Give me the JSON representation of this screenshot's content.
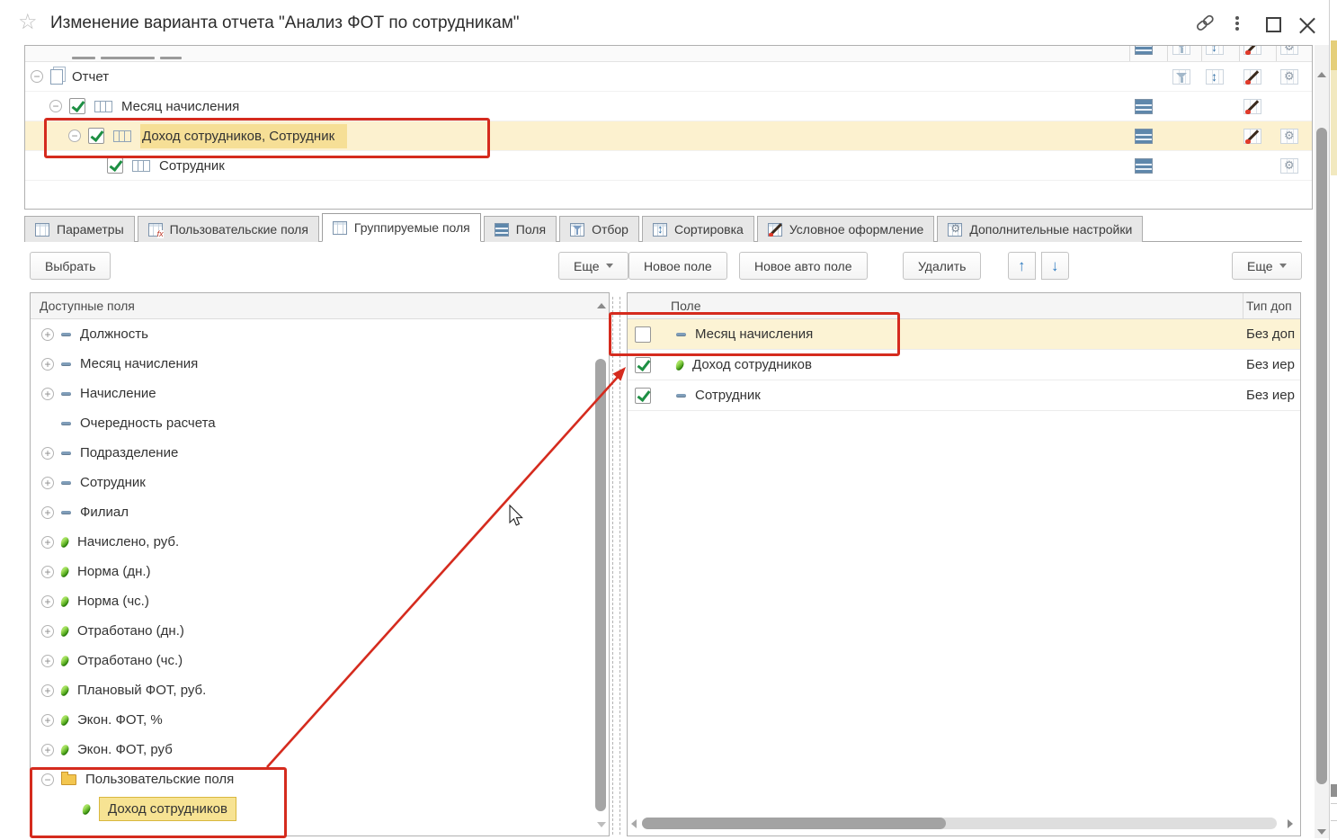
{
  "window": {
    "title": "Изменение варианта отчета \"Анализ ФОТ по сотрудникам\"",
    "controls": [
      "link-icon",
      "menu-kebab-icon",
      "maximize-icon",
      "close-icon"
    ]
  },
  "structure_tree": {
    "rows": [
      {
        "label": "Отчет",
        "level": 0,
        "expander": "minus",
        "icon": "report",
        "checkbox": null,
        "cols": {
          "fields": false,
          "filter": true,
          "sort": true,
          "format": true,
          "settings": true
        },
        "selected": false,
        "annotated": false
      },
      {
        "label": "Месяц начисления",
        "level": 1,
        "expander": "minus",
        "icon": "grouping",
        "checkbox": true,
        "cols": {
          "fields": true,
          "filter": false,
          "sort": false,
          "format": true,
          "settings": false
        },
        "selected": false,
        "annotated": false
      },
      {
        "label": "Доход сотрудников, Сотрудник",
        "level": 2,
        "expander": "minus",
        "icon": "grouping",
        "checkbox": true,
        "cols": {
          "fields": true,
          "filter": false,
          "sort": false,
          "format": true,
          "settings": true
        },
        "selected": true,
        "annotated": true
      },
      {
        "label": "Сотрудник",
        "level": 3,
        "expander": null,
        "icon": "grouping",
        "checkbox": true,
        "cols": {
          "fields": true,
          "filter": false,
          "sort": false,
          "format": false,
          "settings": true
        },
        "selected": false,
        "annotated": false
      }
    ]
  },
  "tabs": [
    {
      "label": "Параметры",
      "icon": "parameters",
      "active": false
    },
    {
      "label": "Пользовательские поля",
      "icon": "userfields",
      "active": false
    },
    {
      "label": "Группируемые поля",
      "icon": "groupfields",
      "active": true
    },
    {
      "label": "Поля",
      "icon": "fields",
      "active": false
    },
    {
      "label": "Отбор",
      "icon": "filter",
      "active": false
    },
    {
      "label": "Сортировка",
      "icon": "sort",
      "active": false
    },
    {
      "label": "Условное оформление",
      "icon": "brush",
      "active": false
    },
    {
      "label": "Дополнительные настройки",
      "icon": "gear",
      "active": false
    }
  ],
  "left_toolbar": {
    "select_label": "Выбрать",
    "more_label": "Еще"
  },
  "right_toolbar": {
    "new_field_label": "Новое поле",
    "new_auto_field_label": "Новое авто поле",
    "delete_label": "Удалить",
    "move_up_icon": "arrow-up",
    "move_down_icon": "arrow-down",
    "more_label": "Еще"
  },
  "left_panel": {
    "header": "Доступные поля",
    "items": [
      {
        "label": "Должность",
        "icon": "dash",
        "expander": "plus",
        "level": 0
      },
      {
        "label": "Месяц начисления",
        "icon": "dash",
        "expander": "plus",
        "level": 0
      },
      {
        "label": "Начисление",
        "icon": "dash",
        "expander": "plus",
        "level": 0
      },
      {
        "label": "Очередность расчета",
        "icon": "dash",
        "expander": null,
        "level": 0
      },
      {
        "label": "Подразделение",
        "icon": "dash",
        "expander": "plus",
        "level": 0
      },
      {
        "label": "Сотрудник",
        "icon": "dash",
        "expander": "plus",
        "level": 0
      },
      {
        "label": "Филиал",
        "icon": "dash",
        "expander": "plus",
        "level": 0
      },
      {
        "label": "Начислено, руб.",
        "icon": "measure",
        "expander": "plus",
        "level": 0
      },
      {
        "label": "Норма (дн.)",
        "icon": "measure",
        "expander": "plus",
        "level": 0
      },
      {
        "label": "Норма (чс.)",
        "icon": "measure",
        "expander": "plus",
        "level": 0
      },
      {
        "label": "Отработано (дн.)",
        "icon": "measure",
        "expander": "plus",
        "level": 0
      },
      {
        "label": "Отработано (чс.)",
        "icon": "measure",
        "expander": "plus",
        "level": 0
      },
      {
        "label": "Плановый ФОТ, руб.",
        "icon": "measure",
        "expander": "plus",
        "level": 0
      },
      {
        "label": "Экон. ФОТ, %",
        "icon": "measure",
        "expander": "plus",
        "level": 0
      },
      {
        "label": "Экон. ФОТ, руб",
        "icon": "measure",
        "expander": "plus",
        "level": 0
      },
      {
        "label": "Пользовательские поля",
        "icon": "folder",
        "expander": "minus",
        "level": 0,
        "annotated": true
      },
      {
        "label": "Доход сотрудников",
        "icon": "measure",
        "expander": null,
        "level": 1,
        "highlighted": true,
        "annotated": true
      }
    ]
  },
  "right_panel": {
    "columns": {
      "field": "Поле",
      "add_type": "Тип доп"
    },
    "rows": [
      {
        "label": "Месяц начисления",
        "icon": "dash",
        "checked": false,
        "type": "Без доп",
        "selected": true,
        "annotated": true
      },
      {
        "label": "Доход сотрудников",
        "icon": "measure",
        "checked": true,
        "type": "Без иер",
        "selected": false,
        "annotated": false
      },
      {
        "label": "Сотрудник",
        "icon": "dash",
        "checked": true,
        "type": "Без иер",
        "selected": false,
        "annotated": false
      }
    ]
  },
  "annotations": {
    "color": "#d52b1e",
    "boxes": [
      "structure-row-income-employee",
      "user-fields-group",
      "field-month-row"
    ],
    "arrow": {
      "from": "user-fields-group",
      "to": "field-month-row"
    }
  },
  "colors": {
    "selection_yellow": "#fcf1cf",
    "highlight_yellow": "#f6df96",
    "annotation_red": "#d52b1e",
    "check_green": "#1d8f43",
    "arrow_blue": "#2f7bc0"
  }
}
